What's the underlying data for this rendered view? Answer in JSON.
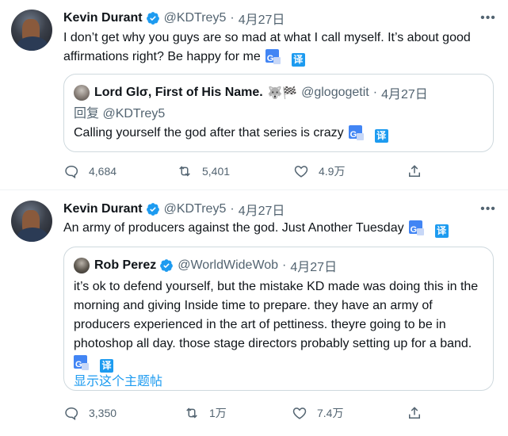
{
  "tweets": [
    {
      "name": "Kevin Durant",
      "handle": "@KDTrey5",
      "dot": "·",
      "date": "4月27日",
      "text": "I don’t get why you guys are so mad  at what I call myself. It’s about good affirmations right? Be happy for me",
      "translate_label": "译",
      "quote": {
        "name": "Lord Glσ, First of His Name.",
        "emoji": "🐺🏁",
        "handle": "@glogogetit",
        "dot": "·",
        "date": "4月27日",
        "reply_to": "回复 @KDTrey5",
        "text": "Calling yourself the god after that series is crazy",
        "translate_label": "译"
      },
      "actions": {
        "replies": "4,684",
        "retweets": "5,401",
        "likes": "4.9万"
      }
    },
    {
      "name": "Kevin Durant",
      "handle": "@KDTrey5",
      "dot": "·",
      "date": "4月27日",
      "text": "An army of producers against the god. Just Another Tuesday",
      "translate_label": "译",
      "quote": {
        "name": "Rob Perez",
        "handle": "@WorldWideWob",
        "dot": "·",
        "date": "4月27日",
        "text": "it’s ok to defend yourself, but the mistake KD made was doing this in the morning and giving Inside time to prepare. they have an army of producers experienced in the art of pettiness. theyre going to be in photoshop all day. those stage directors probably setting up for a band.",
        "translate_label": "译",
        "show_thread": "显示这个主题帖"
      },
      "actions": {
        "replies": "3,350",
        "retweets": "1万",
        "likes": "7.4万"
      }
    }
  ],
  "icons": {
    "more": "more-horizontal-icon",
    "verified": "verified-badge-icon",
    "reply": "reply-icon",
    "retweet": "retweet-icon",
    "like": "heart-icon",
    "share": "share-icon",
    "translate_a": "google-translate-icon",
    "translate_b": "translate-icon"
  },
  "colors": {
    "accent": "#1d9bf0",
    "secondary_text": "#536471",
    "border": "#cfd9de"
  }
}
